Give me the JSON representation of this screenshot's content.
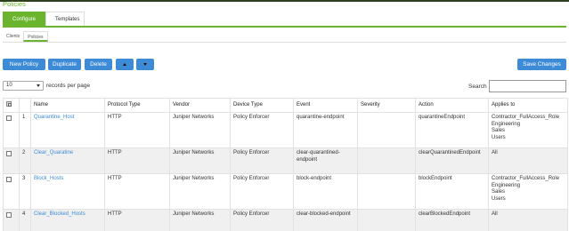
{
  "page": {
    "title": "Policies"
  },
  "tabs": {
    "main": [
      "Configure",
      "Templates"
    ],
    "sub": [
      "Clients",
      "Policies"
    ]
  },
  "toolbar": {
    "new_policy": "New Policy",
    "duplicate": "Duplicate",
    "delete": "Delete",
    "move_up_icon": "arrow-up-icon",
    "move_down_icon": "arrow-down-icon",
    "save_changes": "Save Changes"
  },
  "records": {
    "value": "10",
    "label": "records per page"
  },
  "search": {
    "label": "Search",
    "value": ""
  },
  "table": {
    "headers": [
      "",
      "",
      "Name",
      "Protocol Type",
      "Vendor",
      "Device Type",
      "Event",
      "Severity",
      "Action",
      "Applies to"
    ],
    "rows": [
      {
        "num": "1",
        "name": "Quarantine_Host",
        "protocol": "HTTP",
        "vendor": "Juniper Networks",
        "device": "Policy Enforcer",
        "event": "quarantine-endpoint",
        "severity": "",
        "action": "quarantineEndpoint",
        "applies": [
          "Contractor_FullAccess_Role",
          "Engineering",
          "Sales",
          "Users"
        ]
      },
      {
        "num": "2",
        "name": "Clear_Quaratine",
        "protocol": "HTTP",
        "vendor": "Juniper Networks",
        "device": "Policy Enforcer",
        "event": "clear-quarantined-endpoint",
        "severity": "",
        "action": "clearQuarantinedEndpoint",
        "applies": [
          "All"
        ]
      },
      {
        "num": "3",
        "name": "Block_Hosts",
        "protocol": "HTTP",
        "vendor": "Juniper Networks",
        "device": "Policy Enforcer",
        "event": "block-endpoint",
        "severity": "",
        "action": "blockEndpoint",
        "applies": [
          "Contractor_FullAccess_Role",
          "Engineering",
          "Sales",
          "Users"
        ]
      },
      {
        "num": "4",
        "name": "Clear_Blocked_Hosts",
        "protocol": "HTTP",
        "vendor": "Juniper Networks",
        "device": "Policy Enforcer",
        "event": "clear-blocked-endpoint",
        "severity": "",
        "action": "clearBlockedEndpoint",
        "applies": [
          "All"
        ]
      }
    ]
  },
  "colors": {
    "accent_green": "#6bb52e",
    "button_blue": "#3d8bd6",
    "link_blue": "#3d8bd6"
  }
}
